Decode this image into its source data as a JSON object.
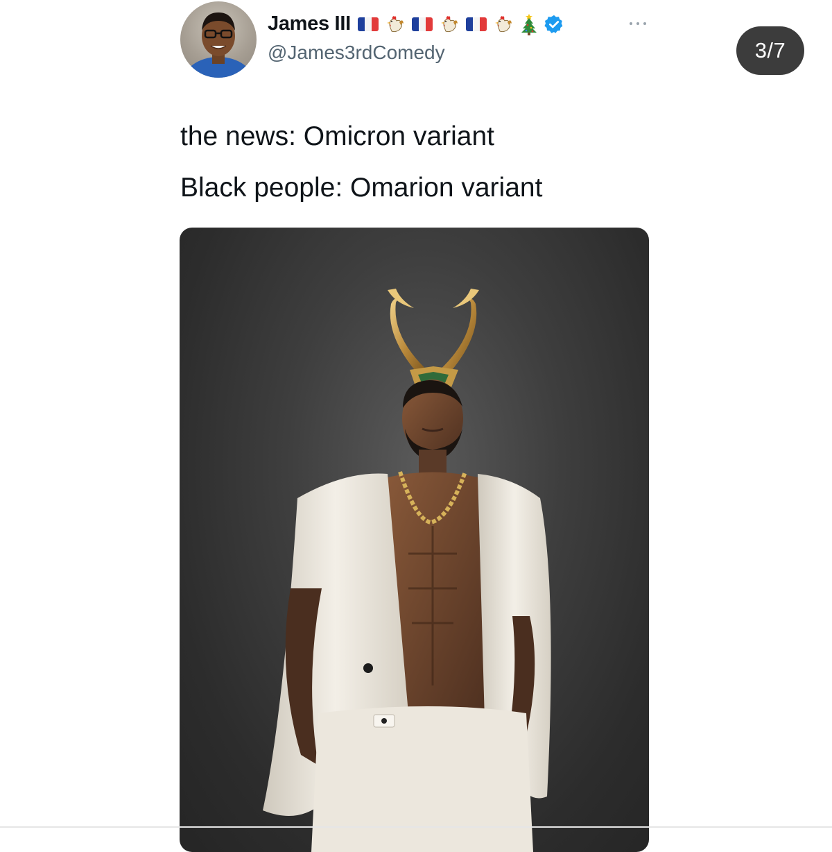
{
  "tweet": {
    "display_name": "James III",
    "name_emoji": [
      "flag-france-icon",
      "rooster-icon",
      "flag-france-icon",
      "rooster-icon",
      "flag-france-icon",
      "rooster-icon",
      "christmas-tree-icon"
    ],
    "verified": true,
    "handle": "@James3rdComedy",
    "text_lines": [
      "the news: Omicron variant",
      "Black people: Omarion variant"
    ],
    "media_icon": "photo-man-white-suit-horned-helmet"
  },
  "viewer": {
    "counter": "3/7"
  },
  "colors": {
    "text_primary": "#0f1419",
    "text_secondary": "#536471",
    "verified_blue": "#1d9bf0",
    "counter_bg": "#3c3c3c",
    "media_bg": "#3a3a3a"
  }
}
